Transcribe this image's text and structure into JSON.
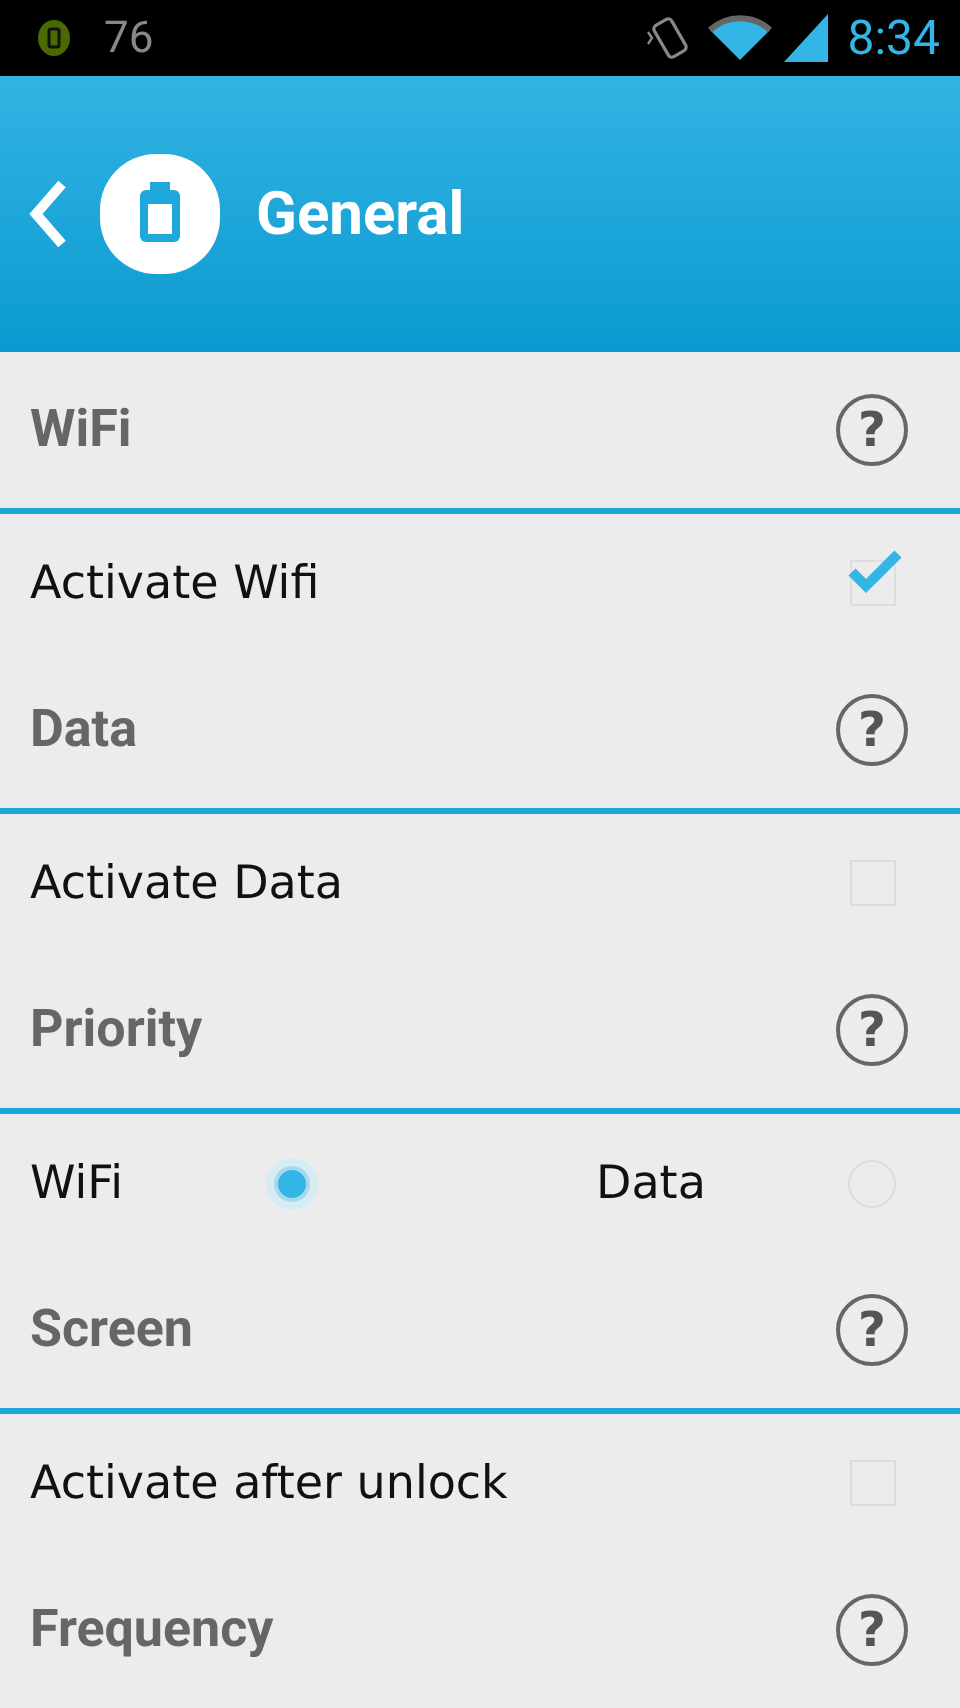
{
  "status_bar": {
    "notification_count": "76",
    "time": "8:34"
  },
  "header": {
    "title": "General"
  },
  "sections": [
    {
      "title": "WiFi",
      "help": "?",
      "row": {
        "kind": "checkbox",
        "label": "Activate Wifi",
        "checked": true
      }
    },
    {
      "title": "Data",
      "help": "?",
      "row": {
        "kind": "checkbox",
        "label": "Activate Data",
        "checked": false
      }
    },
    {
      "title": "Priority",
      "help": "?",
      "row": {
        "kind": "radio",
        "options": [
          {
            "label": "WiFi",
            "selected": true
          },
          {
            "label": "Data",
            "selected": false
          }
        ]
      }
    },
    {
      "title": "Screen",
      "help": "?",
      "row": {
        "kind": "checkbox",
        "label": "Activate after unlock",
        "checked": false
      }
    },
    {
      "title": "Frequency",
      "help": "?"
    }
  ]
}
